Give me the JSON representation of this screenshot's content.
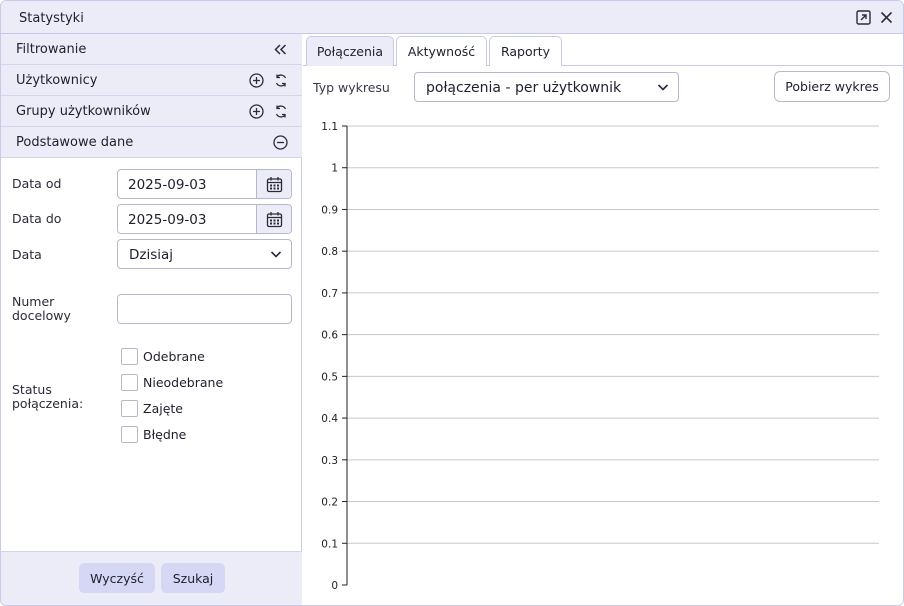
{
  "window": {
    "title": "Statystyki"
  },
  "filter": {
    "header": "Filtrowanie",
    "sections": [
      {
        "label": "Użytkownicy"
      },
      {
        "label": "Grupy użytkowników"
      },
      {
        "label": "Podstawowe dane"
      }
    ],
    "fields": {
      "date_from_label": "Data od",
      "date_from_value": "2025-09-03",
      "date_to_label": "Data do",
      "date_to_value": "2025-09-03",
      "date_label": "Data",
      "date_value": "Dzisiaj",
      "number_label": "Numer docelowy",
      "number_value": "",
      "status_label": "Status połączenia:",
      "statuses": [
        "Odebrane",
        "Nieodebrane",
        "Zajęte",
        "Błędne"
      ]
    },
    "buttons": {
      "clear": "Wyczyść",
      "search": "Szukaj"
    }
  },
  "main": {
    "tabs": [
      "Połączenia",
      "Aktywność",
      "Raporty"
    ],
    "active_tab": 0,
    "chart_type_label": "Typ wykresu",
    "chart_type_value": "połączenia - per użytkownik",
    "download_button": "Pobierz wykres"
  },
  "colors": {
    "accent": "#ececf8",
    "button": "#d6d6f5",
    "border": "#c9c9e8"
  },
  "chart_data": {
    "type": "bar",
    "categories": [],
    "values": [],
    "ylim": [
      0,
      1.1
    ],
    "y_ticks": [
      "0",
      "0.1",
      "0.2",
      "0.3",
      "0.4",
      "0.5",
      "0.6",
      "0.7",
      "0.8",
      "0.9",
      "1",
      "1.1"
    ],
    "grid": true
  }
}
